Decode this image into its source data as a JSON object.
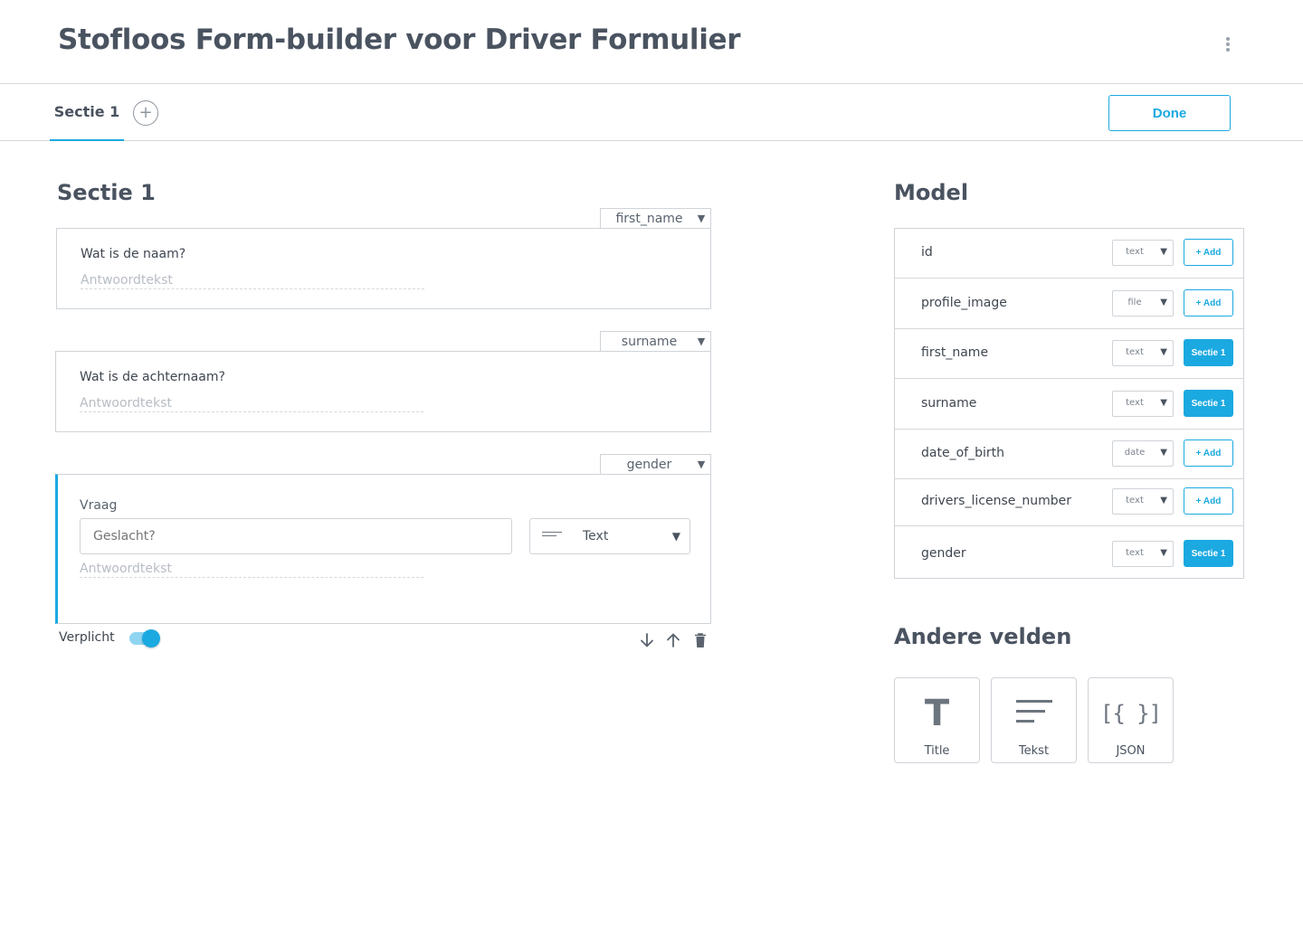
{
  "header": {
    "title": "Stofloos Form-builder voor Driver Formulier"
  },
  "tabs": {
    "items": [
      {
        "label": "Sectie 1"
      }
    ],
    "add_label": "+",
    "done_label": "Done"
  },
  "section": {
    "title": "Sectie 1",
    "questions": [
      {
        "field": "first_name",
        "question": "Wat is de naam?",
        "answer_placeholder": "Antwoordtekst"
      },
      {
        "field": "surname",
        "question": "Wat is de achternaam?",
        "answer_placeholder": "Antwoordtekst"
      },
      {
        "field": "gender",
        "vraag_label": "Vraag",
        "question_placeholder": "Geslacht?",
        "type": "Text",
        "answer_placeholder": "Antwoordtekst"
      }
    ],
    "verplicht_label": "Verplicht",
    "verplicht_on": true
  },
  "model": {
    "title": "Model",
    "rows": [
      {
        "name": "id",
        "type": "text",
        "action": "+ Add",
        "assigned": false
      },
      {
        "name": "profile_image",
        "type": "file",
        "action": "+ Add",
        "assigned": false
      },
      {
        "name": "first_name",
        "type": "text",
        "action": "Sectie 1",
        "assigned": true
      },
      {
        "name": "surname",
        "type": "text",
        "action": "Sectie 1",
        "assigned": true
      },
      {
        "name": "date_of_birth",
        "type": "date",
        "action": "+ Add",
        "assigned": false
      },
      {
        "name": "drivers_license_number",
        "type": "text",
        "action": "+ Add",
        "assigned": false
      },
      {
        "name": "gender",
        "type": "text",
        "action": "Sectie 1",
        "assigned": true
      }
    ]
  },
  "other_fields": {
    "title": "Andere velden",
    "tiles": [
      {
        "label": "Title",
        "icon": "title-T-icon",
        "glyph": "T"
      },
      {
        "label": "Tekst",
        "icon": "text-lines-icon"
      },
      {
        "label": "JSON",
        "icon": "json-brackets-icon",
        "glyph": "[{ }]"
      }
    ]
  },
  "colors": {
    "accent": "#1ba9e1",
    "text": "#4a5360",
    "border": "#cfd3d8"
  }
}
